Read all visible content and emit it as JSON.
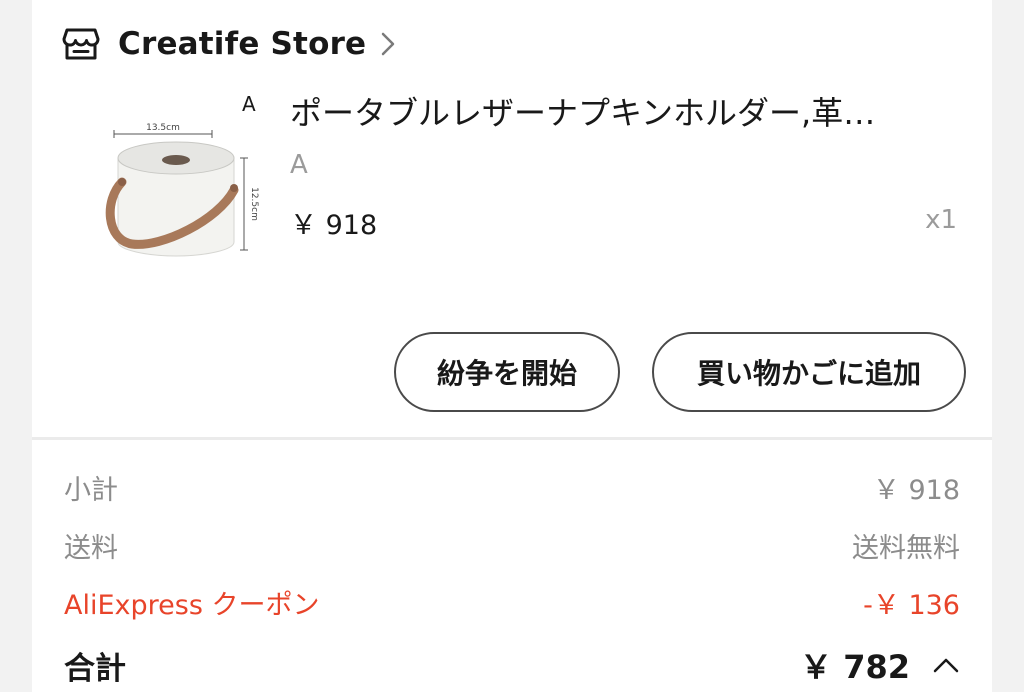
{
  "store": {
    "name": "Creatife Store",
    "icon": "store-icon",
    "chevron": "chevron-right-icon"
  },
  "product": {
    "variant_marker": "A",
    "title": "ポータブルレザーナプキンホルダー,革…",
    "variant": "A",
    "price": "￥ 918",
    "quantity": "x1",
    "image": {
      "width_label": "13.5cm",
      "height_label": "12.5cm"
    }
  },
  "actions": {
    "dispute_label": "紛争を開始",
    "add_to_cart_label": "買い物かごに追加"
  },
  "summary": {
    "subtotal_label": "小計",
    "subtotal_value": "￥ 918",
    "shipping_label": "送料",
    "shipping_value": "送料無料",
    "coupon_label": "AliExpress クーポン",
    "coupon_value": "-￥ 136",
    "total_label": "合計",
    "total_value": "￥ 782"
  },
  "colors": {
    "coupon": "#e8442a",
    "text": "#191919",
    "muted": "#8c8c8c"
  }
}
